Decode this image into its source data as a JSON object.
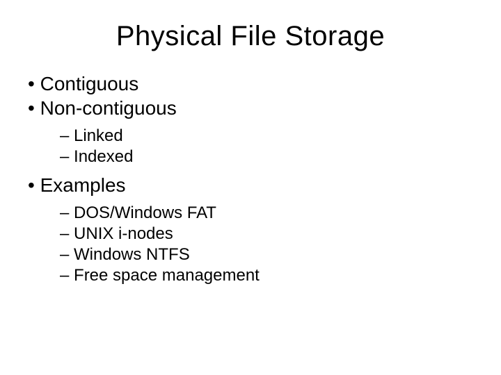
{
  "slide": {
    "title": "Physical File Storage",
    "bullets": {
      "b1": "Contiguous",
      "b2": "Non-contiguous",
      "b2_sub1": "Linked",
      "b2_sub2": "Indexed",
      "b3": "Examples",
      "b3_sub1": "DOS/Windows FAT",
      "b3_sub2": "UNIX i-nodes",
      "b3_sub3": "Windows NTFS",
      "b3_sub4": "Free space management"
    },
    "markers": {
      "dot": "•",
      "dash": "–"
    }
  }
}
